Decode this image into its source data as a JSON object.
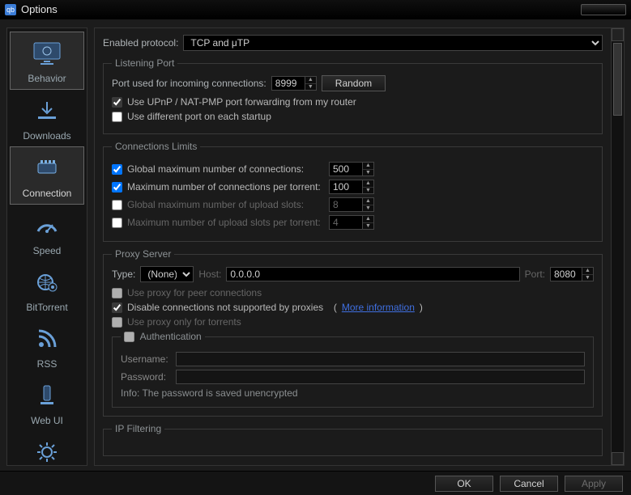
{
  "window": {
    "title": "Options"
  },
  "sidebar": {
    "items": [
      {
        "label": "Behavior"
      },
      {
        "label": "Downloads"
      },
      {
        "label": "Connection"
      },
      {
        "label": "Speed"
      },
      {
        "label": "BitTorrent"
      },
      {
        "label": "RSS"
      },
      {
        "label": "Web UI"
      },
      {
        "label": "Advanced"
      }
    ]
  },
  "protocol": {
    "label": "Enabled protocol:",
    "value": "TCP and μTP"
  },
  "listening": {
    "legend": "Listening Port",
    "port_label": "Port used for incoming connections:",
    "port_value": "8999",
    "random_btn": "Random",
    "upnp_label": "Use UPnP / NAT-PMP port forwarding from my router",
    "upnp_checked": true,
    "diffport_label": "Use different port on each startup",
    "diffport_checked": false
  },
  "limits": {
    "legend": "Connections Limits",
    "rows": [
      {
        "label": "Global maximum number of connections:",
        "checked": true,
        "value": "500",
        "enabled": true
      },
      {
        "label": "Maximum number of connections per torrent:",
        "checked": true,
        "value": "100",
        "enabled": true
      },
      {
        "label": "Global maximum number of upload slots:",
        "checked": false,
        "value": "8",
        "enabled": false
      },
      {
        "label": "Maximum number of upload slots per torrent:",
        "checked": false,
        "value": "4",
        "enabled": false
      }
    ]
  },
  "proxy": {
    "legend": "Proxy Server",
    "type_label": "Type:",
    "type_value": "(None)",
    "host_label": "Host:",
    "host_value": "0.0.0.0",
    "port_label": "Port:",
    "port_value": "8080",
    "peer_label": "Use proxy for peer connections",
    "peer_checked": false,
    "disable_label": "Disable connections not supported by proxies",
    "disable_checked": true,
    "moreinfo": "More information",
    "torrents_only_label": "Use proxy only for torrents",
    "torrents_only_checked": false,
    "auth": {
      "legend": "Authentication",
      "enabled": false,
      "user_label": "Username:",
      "user_value": "",
      "pass_label": "Password:",
      "pass_value": "",
      "info": "Info: The password is saved unencrypted"
    }
  },
  "ipfilter": {
    "legend": "IP Filtering"
  },
  "footer": {
    "ok": "OK",
    "cancel": "Cancel",
    "apply": "Apply"
  }
}
